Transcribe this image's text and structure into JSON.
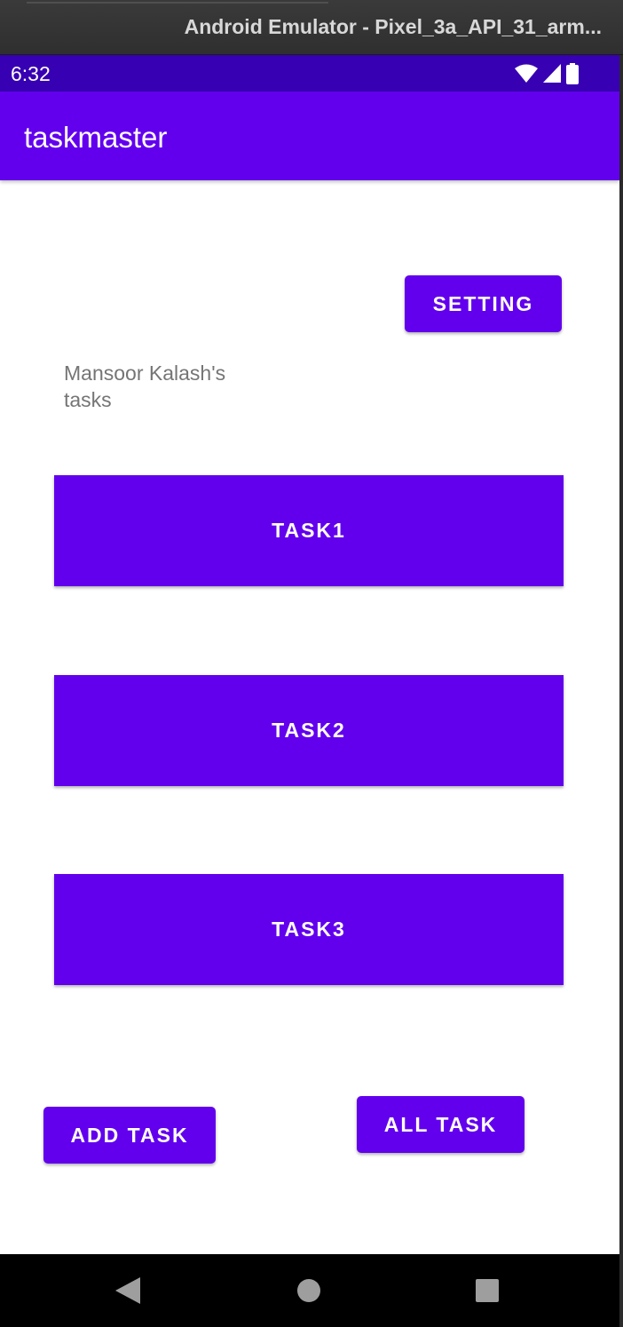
{
  "window": {
    "title": "Android Emulator - Pixel_3a_API_31_arm..."
  },
  "status_bar": {
    "time": "6:32",
    "icons": [
      "wifi-icon",
      "cell-signal-icon",
      "battery-icon"
    ],
    "color": "#3700b3"
  },
  "app_bar": {
    "title": "taskmaster",
    "color": "#6200ee"
  },
  "main": {
    "setting_button": "SETTING",
    "owner_tasks_label": "Mansoor Kalash's tasks",
    "tasks": [
      {
        "label": "TASK1"
      },
      {
        "label": "TASK2"
      },
      {
        "label": "TASK3"
      }
    ],
    "add_task_button": "ADD TASK",
    "all_task_button": "ALL TASK"
  },
  "nav_bar": {
    "buttons": [
      "back-icon",
      "home-icon",
      "recents-icon"
    ]
  },
  "colors": {
    "primary": "#6200ee",
    "primary_dark": "#3700b3",
    "secondary_text": "#757575"
  }
}
